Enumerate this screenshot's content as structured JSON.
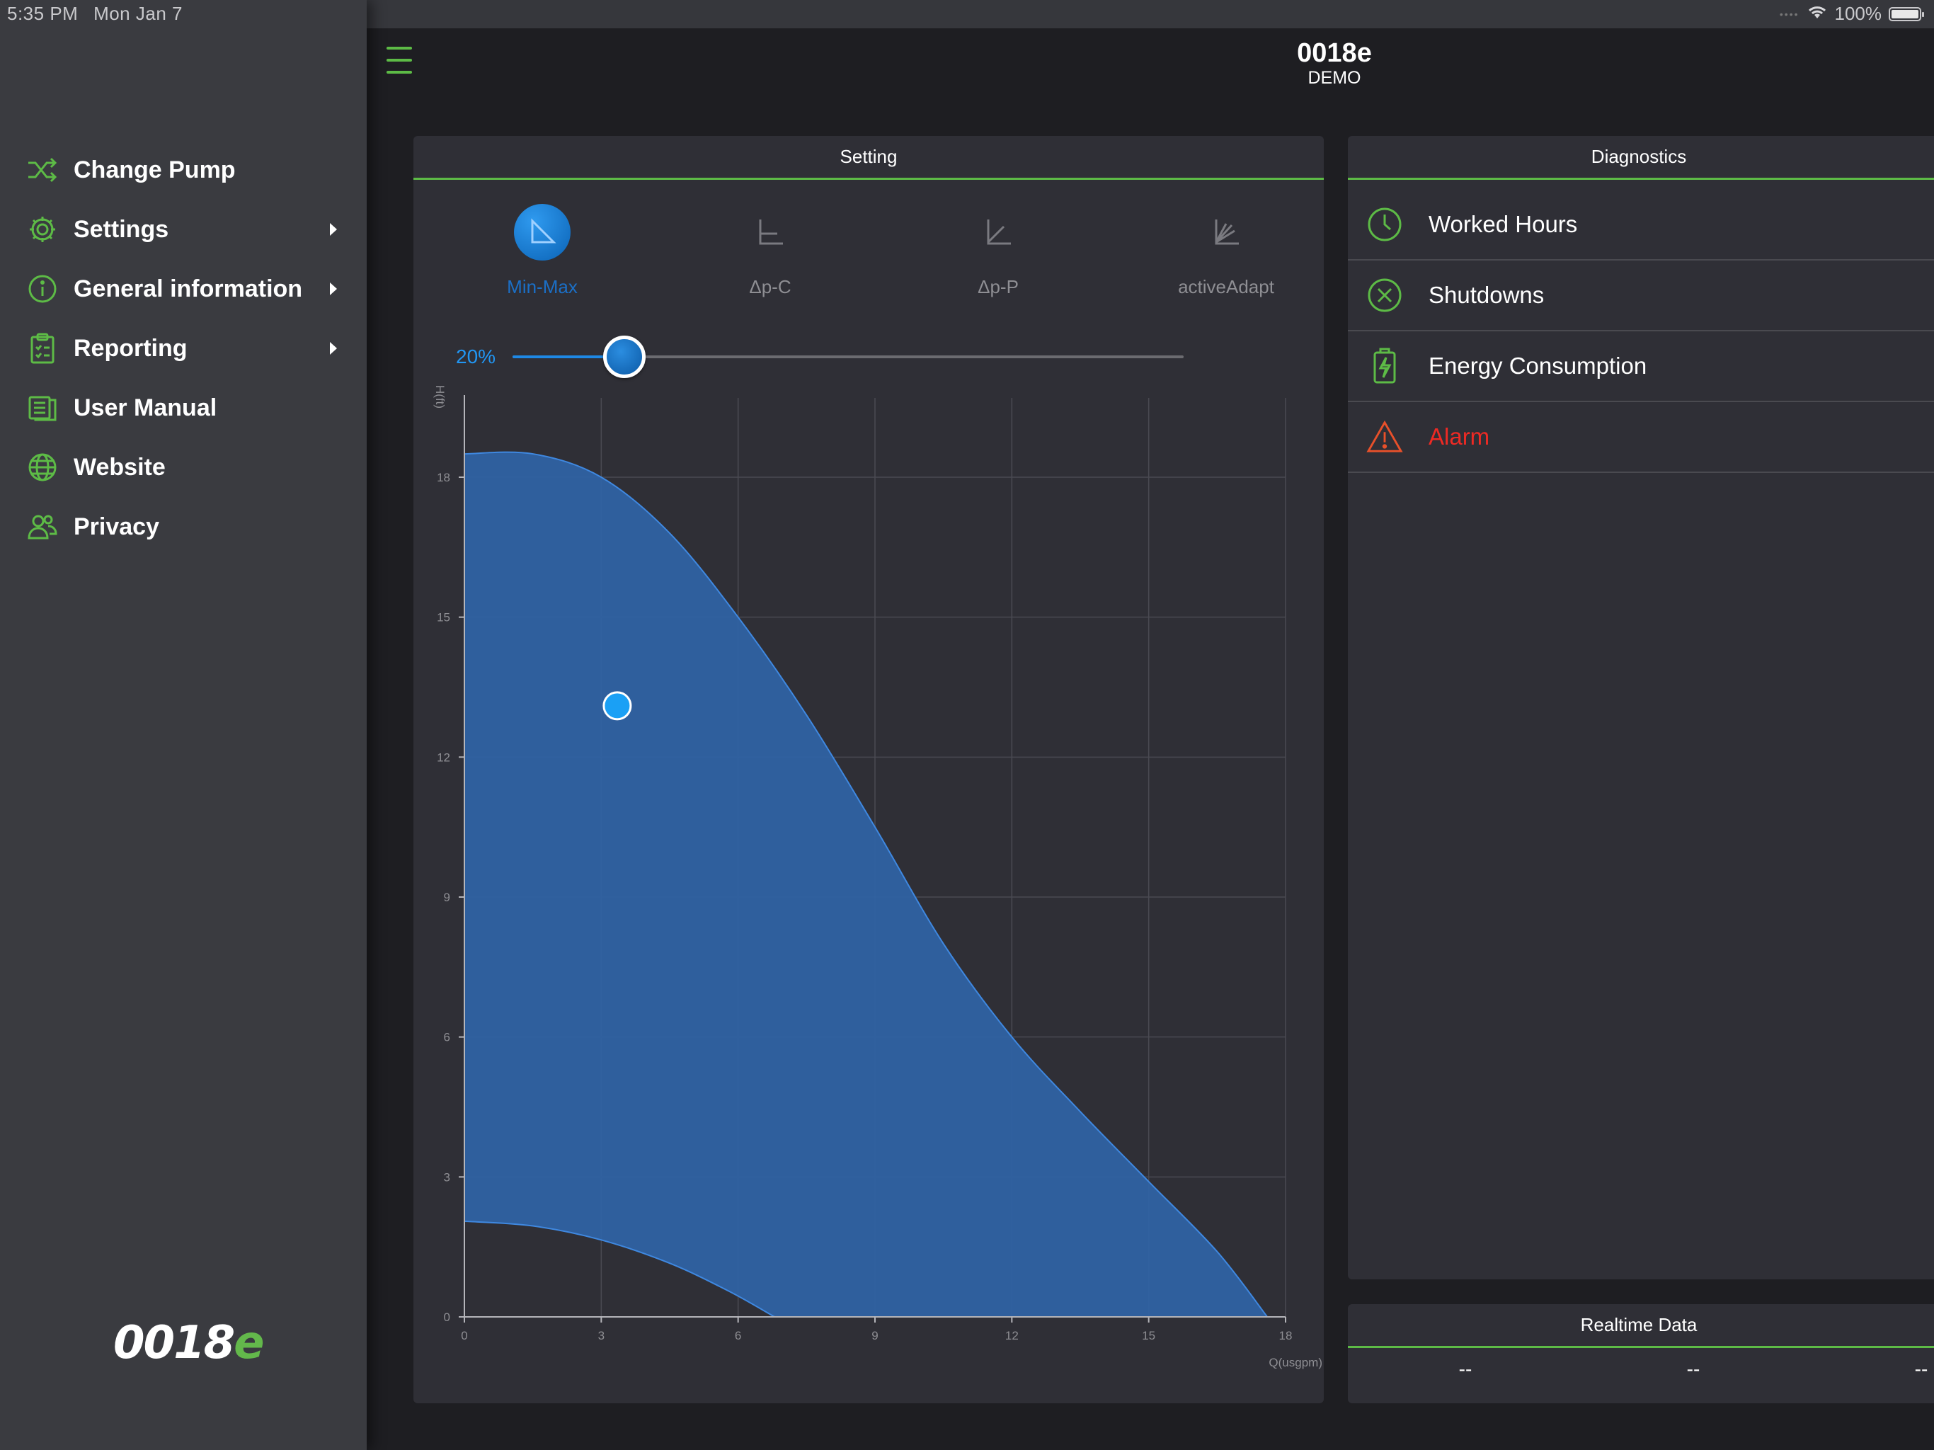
{
  "status": {
    "time": "5:35 PM",
    "date": "Mon Jan 7",
    "battery": "100%"
  },
  "header": {
    "title": "0018e",
    "subtitle": "DEMO"
  },
  "sidebar": {
    "items": [
      {
        "label": "Change Pump",
        "icon": "shuffle-icon"
      },
      {
        "label": "Settings",
        "icon": "gear-icon"
      },
      {
        "label": "General information",
        "icon": "info-icon"
      },
      {
        "label": "Reporting",
        "icon": "clipboard-icon"
      },
      {
        "label": "User Manual",
        "icon": "book-icon"
      },
      {
        "label": "Website",
        "icon": "globe-icon"
      },
      {
        "label": "Privacy",
        "icon": "people-icon"
      }
    ],
    "logo_main": "0018",
    "logo_accent": "e"
  },
  "setting": {
    "title": "Setting",
    "modes": [
      {
        "label": "Min-Max",
        "icon": "min-max-icon",
        "active": true
      },
      {
        "label": "Δp-C",
        "icon": "dp-c-icon",
        "active": false
      },
      {
        "label": "Δp-P",
        "icon": "dp-p-icon",
        "active": false
      },
      {
        "label": "activeAdapt",
        "icon": "active-adapt-icon",
        "active": false
      }
    ],
    "slider": {
      "value_text": "20%",
      "value": 0.2
    }
  },
  "diagnostics": {
    "title": "Diagnostics",
    "items": [
      {
        "label": "Worked Hours",
        "icon": "clock-icon"
      },
      {
        "label": "Shutdowns",
        "icon": "x-circle-icon"
      },
      {
        "label": "Energy Consumption",
        "icon": "battery-bolt-icon"
      },
      {
        "label": "Alarm",
        "icon": "warning-icon"
      }
    ]
  },
  "realtime": {
    "title": "Realtime Data",
    "values": [
      "--",
      "--",
      "--"
    ]
  },
  "colors": {
    "accent": "#5dbb46",
    "blue": "#1e88e5",
    "alarm": "#ee2a24",
    "area": "#2f62a3"
  },
  "chart_data": {
    "type": "area",
    "xlabel": "Q(usgpm)",
    "ylabel": "H(ft)",
    "xlim": [
      0,
      18
    ],
    "ylim": [
      0,
      19.7
    ],
    "xticks": [
      0,
      3,
      6,
      9,
      12,
      15,
      18
    ],
    "yticks": [
      0,
      3,
      6,
      9,
      12,
      15,
      18
    ],
    "grid": true,
    "upper_curve": {
      "x": [
        0,
        1.5,
        3,
        4.5,
        6,
        7.5,
        9,
        10.5,
        12,
        13.5,
        15,
        16.5,
        17.6
      ],
      "y": [
        18.5,
        18.5,
        18.0,
        16.8,
        15.0,
        12.9,
        10.5,
        8.0,
        6.0,
        4.4,
        2.9,
        1.4,
        0
      ]
    },
    "lower_curve": {
      "x": [
        0,
        1.5,
        3,
        4.5,
        5.8,
        6.8
      ],
      "y": [
        2.05,
        1.95,
        1.65,
        1.15,
        0.55,
        0
      ]
    },
    "operating_point": {
      "x": 3.35,
      "y": 13.1
    }
  }
}
